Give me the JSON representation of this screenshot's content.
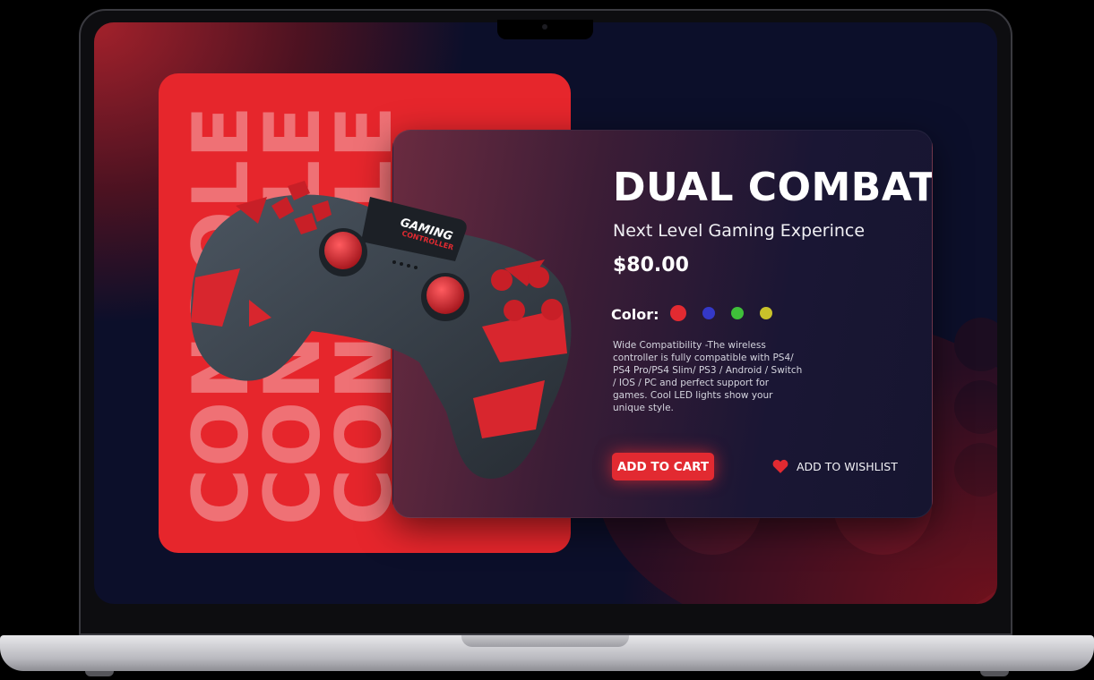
{
  "poster": {
    "words": [
      "CONSOLE",
      "CONSOLE",
      "CONSOLE"
    ]
  },
  "product": {
    "title": "DUAL COMBAT",
    "subtitle": "Next Level Gaming Experince",
    "price": "$80.00",
    "color_label": "Color:",
    "colors": [
      "#e22a31",
      "#3438c8",
      "#3fbf3a",
      "#c9c22a"
    ],
    "description": "Wide Compatibility -The wireless controller is fully compatible with PS4/ PS4 Pro/PS4 Slim/ PS3 / Android / Switch / IOS / PC and perfect support for games. Cool LED lights show your unique style.",
    "add_to_cart": "ADD TO CART",
    "wishlist": "ADD TO WISHLIST"
  },
  "controller": {
    "brand_line1": "GAMING",
    "brand_line2": "CONTROLLER"
  },
  "theme": {
    "accent": "#e22a31",
    "poster_red": "#e6262c",
    "dark_navy": "#0c0f2a"
  }
}
